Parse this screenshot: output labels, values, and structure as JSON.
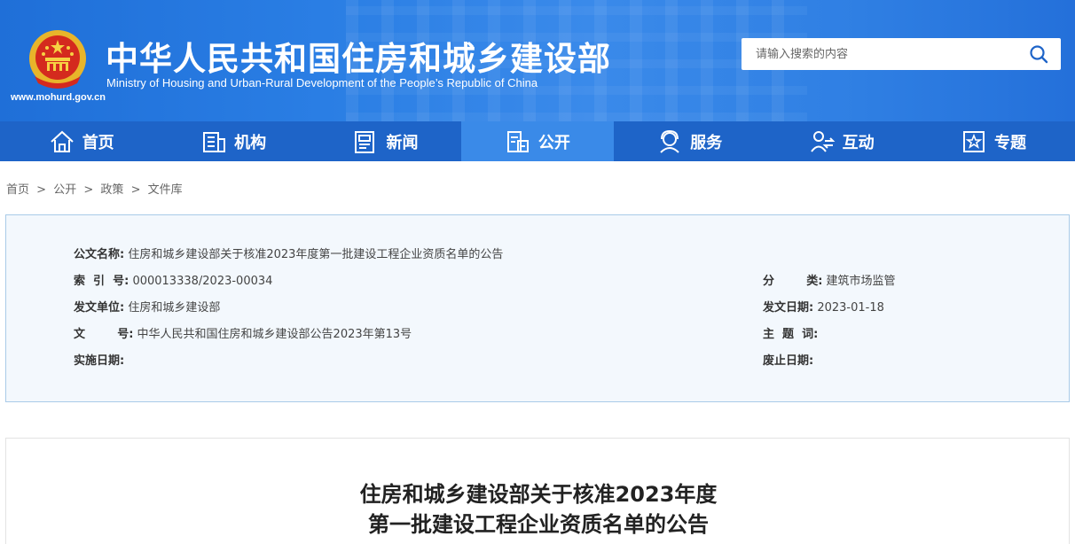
{
  "header": {
    "title_cn": "中华人民共和国住房和城乡建设部",
    "title_en": "Ministry of Housing and Urban-Rural Development of the People’s Republic of China",
    "site_url": "www.mohurd.gov.cn",
    "emblem_icon": "national-emblem-icon",
    "search": {
      "placeholder": "请输入搜索的内容",
      "value": "",
      "icon": "search-icon"
    }
  },
  "nav": {
    "items": [
      {
        "label": "首页",
        "icon": "home-icon"
      },
      {
        "label": "机构",
        "icon": "building-icon"
      },
      {
        "label": "新闻",
        "icon": "newspaper-icon"
      },
      {
        "label": "公开",
        "icon": "document-icon",
        "active": true
      },
      {
        "label": "服务",
        "icon": "service-icon"
      },
      {
        "label": "互动",
        "icon": "interaction-icon"
      },
      {
        "label": "专题",
        "icon": "star-badge-icon"
      }
    ]
  },
  "breadcrumb": {
    "items": [
      "首页",
      "公开",
      "政策",
      "文件库"
    ],
    "separator": ">"
  },
  "info": {
    "doc_name_label": "公文名称:",
    "doc_name": "住房和城乡建设部关于核准2023年度第一批建设工程企业资质名单的公告",
    "index_label": "索  引  号:",
    "index": "000013338/2023-00034",
    "category_label": "分        类:",
    "category": "建筑市场监管",
    "issuer_label": "发文单位:",
    "issuer": "住房和城乡建设部",
    "date_label": "发文日期:",
    "date": "2023-01-18",
    "doc_no_label": "文        号:",
    "doc_no": "中华人民共和国住房和城乡建设部公告2023年第13号",
    "topic_label": "主  题  词:",
    "topic": "",
    "effective_label": "实施日期:",
    "effective": "",
    "expire_label": "废止日期:",
    "expire": ""
  },
  "article": {
    "title_line1": "住房和城乡建设部关于核准2023年度",
    "title_line2": "第一批建设工程企业资质名单的公告"
  },
  "colors": {
    "header_blue": "#2a7ee4",
    "nav_blue": "#1e64c8",
    "nav_active": "#3a8ae8",
    "info_bg": "#f3f8fd",
    "info_border": "#a9cbe8"
  }
}
